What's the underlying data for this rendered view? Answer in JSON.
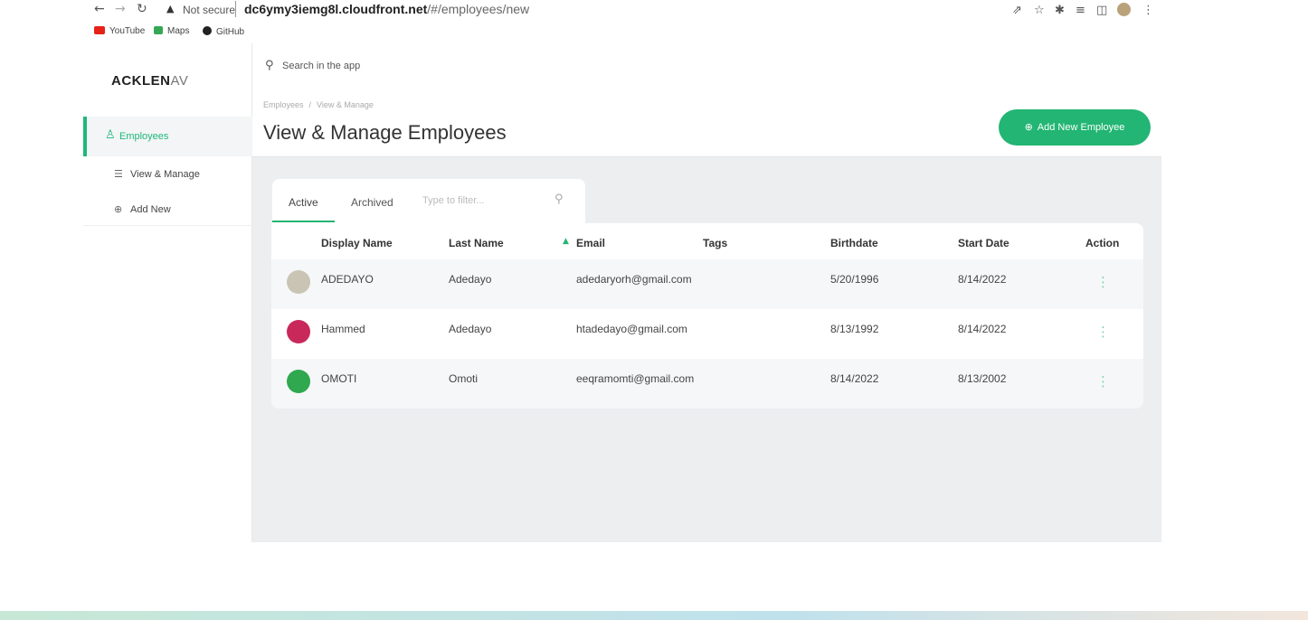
{
  "browser": {
    "security": "Not secure",
    "url_host": "dc6ymy3iemg8l.cloudfront.net",
    "url_path": "/#/employees/new",
    "bookmarks": [
      {
        "label": "YouTube",
        "color": "#e62117"
      },
      {
        "label": "Maps",
        "color": "#34a853"
      },
      {
        "label": "GitHub",
        "color": "#222222"
      }
    ]
  },
  "sidebar": {
    "logo_bold": "ACKLEN",
    "logo_light": "AV",
    "section": "Employees",
    "items": [
      {
        "label": "View & Manage",
        "icon": "list-icon"
      },
      {
        "label": "Add New",
        "icon": "plus-circle-icon"
      }
    ]
  },
  "header": {
    "search_placeholder": "Search in the app",
    "breadcrumb": [
      "Employees",
      "/",
      "View & Manage"
    ],
    "title": "View & Manage Employees",
    "add_button": "Add New Employee"
  },
  "tabs": {
    "active": "Active",
    "archived": "Archived",
    "filter_placeholder": "Type to filter..."
  },
  "table": {
    "columns": [
      "Display Name",
      "Last Name",
      "Email",
      "Tags",
      "Birthdate",
      "Start Date",
      "Action"
    ],
    "rows": [
      {
        "display_name": "ADEDAYO",
        "last_name": "Adedayo",
        "email": "adedaryorh@gmail.com",
        "tags": "",
        "birthdate": "5/20/1996",
        "start_date": "8/14/2022",
        "avatar_color": "#c9c4b4"
      },
      {
        "display_name": "Hammed",
        "last_name": "Adedayo",
        "email": "htadedayo@gmail.com",
        "tags": "",
        "birthdate": "8/13/1992",
        "start_date": "8/14/2022",
        "avatar_color": "#c9285b"
      },
      {
        "display_name": "OMOTI",
        "last_name": "Omoti",
        "email": "eeqramomti@gmail.com",
        "tags": "",
        "birthdate": "8/14/2022",
        "start_date": "8/13/2002",
        "avatar_color": "#2fa84f"
      }
    ]
  },
  "colors": {
    "accent": "#22b573"
  }
}
